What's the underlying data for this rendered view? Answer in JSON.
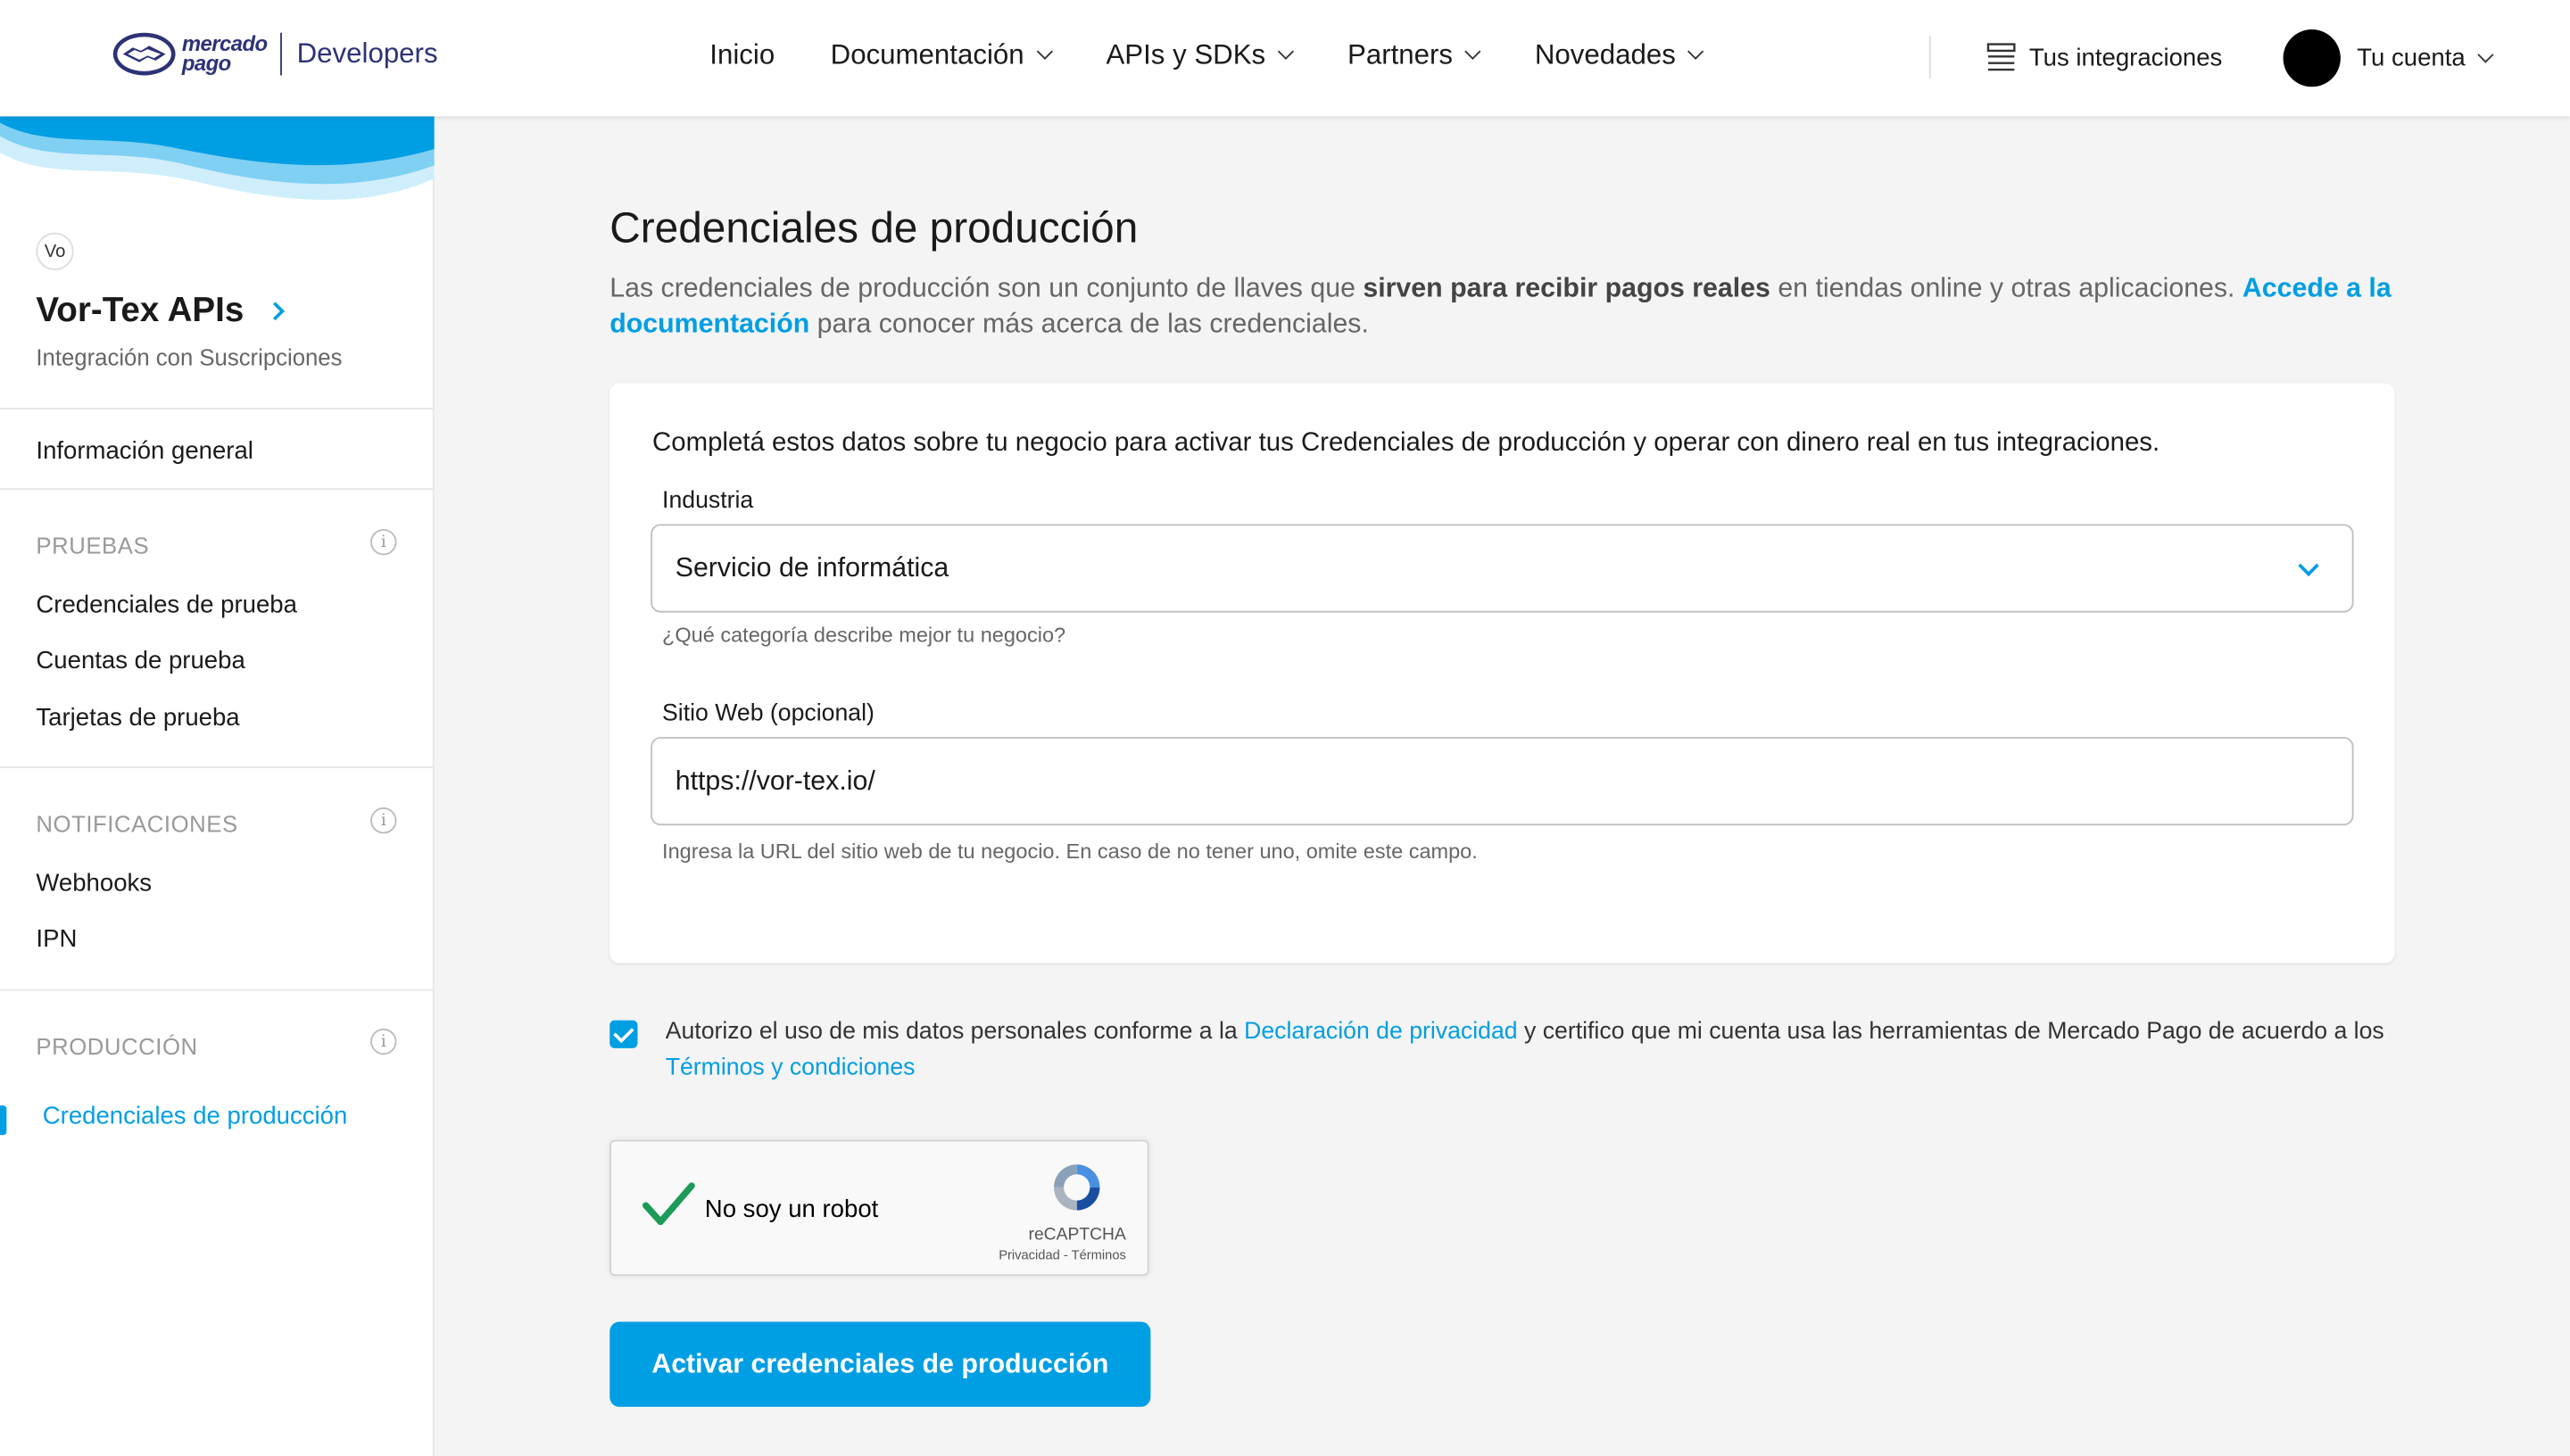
{
  "header": {
    "logo_text_line1": "mercado",
    "logo_text_line2": "pago",
    "logo_product": "Developers",
    "nav": [
      {
        "label": "Inicio"
      },
      {
        "label": "Documentación"
      },
      {
        "label": "APIs y SDKs"
      },
      {
        "label": "Partners"
      },
      {
        "label": "Novedades"
      }
    ],
    "integrations_label": "Tus integraciones",
    "account_label": "Tu cuenta"
  },
  "sidebar": {
    "project_badge": "Vo",
    "project_name": "Vor-Tex APIs",
    "project_subtitle": "Integración con Suscripciones",
    "general_info": "Información general",
    "sections": [
      {
        "title": "PRUEBAS",
        "items": [
          "Credenciales de prueba",
          "Cuentas de prueba",
          "Tarjetas de prueba"
        ]
      },
      {
        "title": "NOTIFICACIONES",
        "items": [
          "Webhooks",
          "IPN"
        ]
      },
      {
        "title": "PRODUCCIÓN",
        "items": [
          "Credenciales de producción"
        ]
      }
    ],
    "info_glyph": "i"
  },
  "main": {
    "title": "Credenciales de producción",
    "desc_part1": "Las credenciales de producción son un conjunto de llaves que ",
    "desc_bold": "sirven para recibir pagos reales",
    "desc_part2": " en tiendas online y otras aplicaciones. ",
    "desc_link": "Accede a la documentación",
    "desc_part3": " para conocer más acerca de las credenciales.",
    "card_intro": "Completá estos datos sobre tu negocio para activar tus Credenciales de producción y operar con dinero real en tus integraciones.",
    "industry_label": "Industria",
    "industry_value": "Servicio de informática",
    "industry_helper": "¿Qué categoría describe mejor tu negocio?",
    "website_label": "Sitio Web (opcional)",
    "website_value": "https://vor-tex.io/",
    "website_helper": "Ingresa la URL del sitio web de tu negocio. En caso de no tener uno, omite este campo.",
    "consent_part1": "Autorizo el uso de mis datos personales conforme a la ",
    "consent_link1": "Declaración de privacidad",
    "consent_part2": " y certifico que mi cuenta usa las herramientas de Mercado Pago de acuerdo a los ",
    "consent_link2": "Términos y condiciones",
    "consent_checked": true,
    "captcha_label": "No soy un robot",
    "captcha_brand": "reCAPTCHA",
    "captcha_links": "Privacidad - Términos",
    "submit_label": "Activar credenciales de producción"
  },
  "colors": {
    "accent": "#009ee3",
    "brand_navy": "#2d3277",
    "background": "#f4f4f4"
  },
  "icons": {
    "logo": "handshake-logo-icon",
    "integrations": "list-icon",
    "chevron": "chevron-down-icon",
    "captcha_check": "green-check-icon",
    "captcha_logo": "recaptcha-icon"
  }
}
